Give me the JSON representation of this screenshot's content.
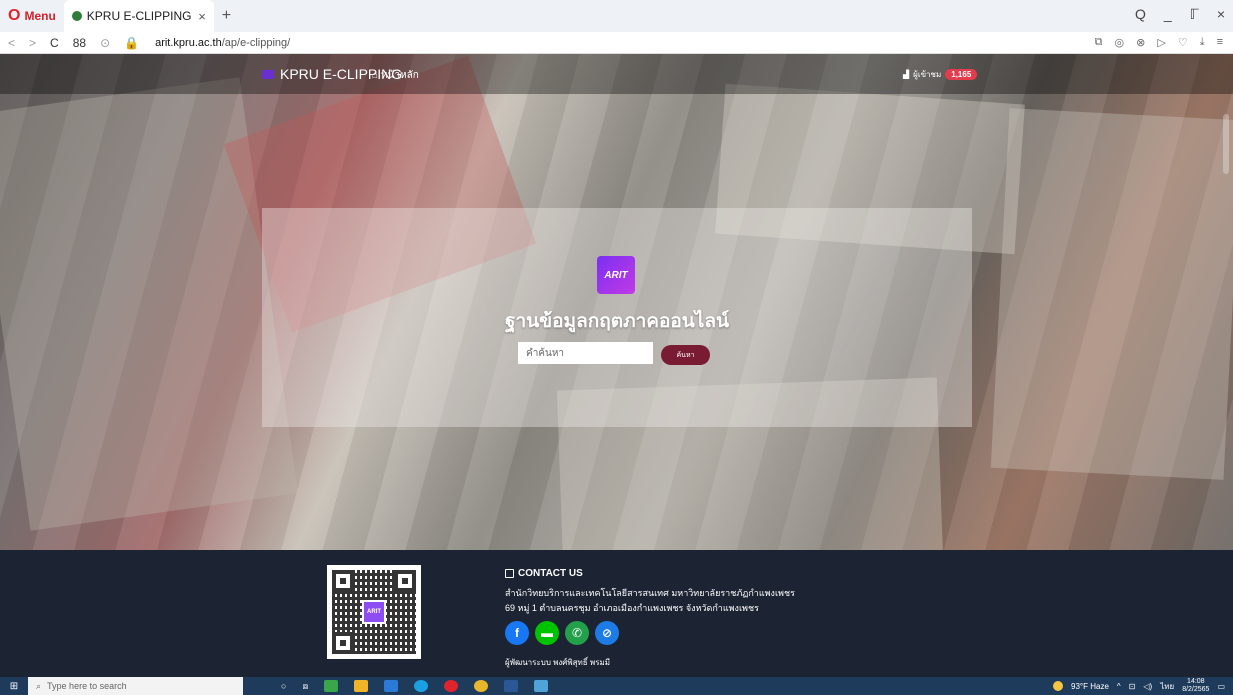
{
  "browser": {
    "menu_label": "Menu",
    "tab_title": "KPRU E-CLIPPING",
    "tab_close": "×",
    "new_tab": "+",
    "url_host": "arit.kpru.ac.th",
    "url_path": "/ap/e-clipping/",
    "window_controls": [
      "Q",
      "_",
      "ℾ",
      "×"
    ]
  },
  "site": {
    "brand": "KPRU E-CLIPPING",
    "home_link": "หน้าหลัก",
    "visitors_label": "ผู้เข้าชม",
    "visitors_count": "1,165"
  },
  "hero": {
    "logo_text": "ARIT",
    "title": "ฐานข้อมูลกฤตภาคออนไลน์",
    "search_placeholder": "คำค้นหา",
    "search_button": "ค้นหา"
  },
  "footer": {
    "qr_label": "ARIT",
    "contact_title": "CONTACT US",
    "organization": "สำนักวิทยบริการและเทคโนโลยีสารสนเทศ มหาวิทยาลัยราชภัฏกำแพงเพชร",
    "address": "69 หมู่ 1 ตำบลนครชุม อำเภอเมืองกำแพงเพชร จังหวัดกำแพงเพชร",
    "credit": "ผู้พัฒนาระบบ พงศ์พิสุทธิ์ พรมมี",
    "social": [
      {
        "name": "facebook-icon",
        "glyph": "f"
      },
      {
        "name": "line-icon",
        "glyph": "▬"
      },
      {
        "name": "phone-icon",
        "glyph": "✆"
      },
      {
        "name": "link-icon",
        "glyph": "⊘"
      }
    ]
  },
  "taskbar": {
    "search_placeholder": "Type here to search",
    "weather": "93°F Haze",
    "lang": "ไทย",
    "time": "14:08",
    "date": "8/2/2565"
  },
  "colors": {
    "accent": "#7a1b34",
    "footer_bg": "#1c2333",
    "badge": "#e43c4c"
  }
}
